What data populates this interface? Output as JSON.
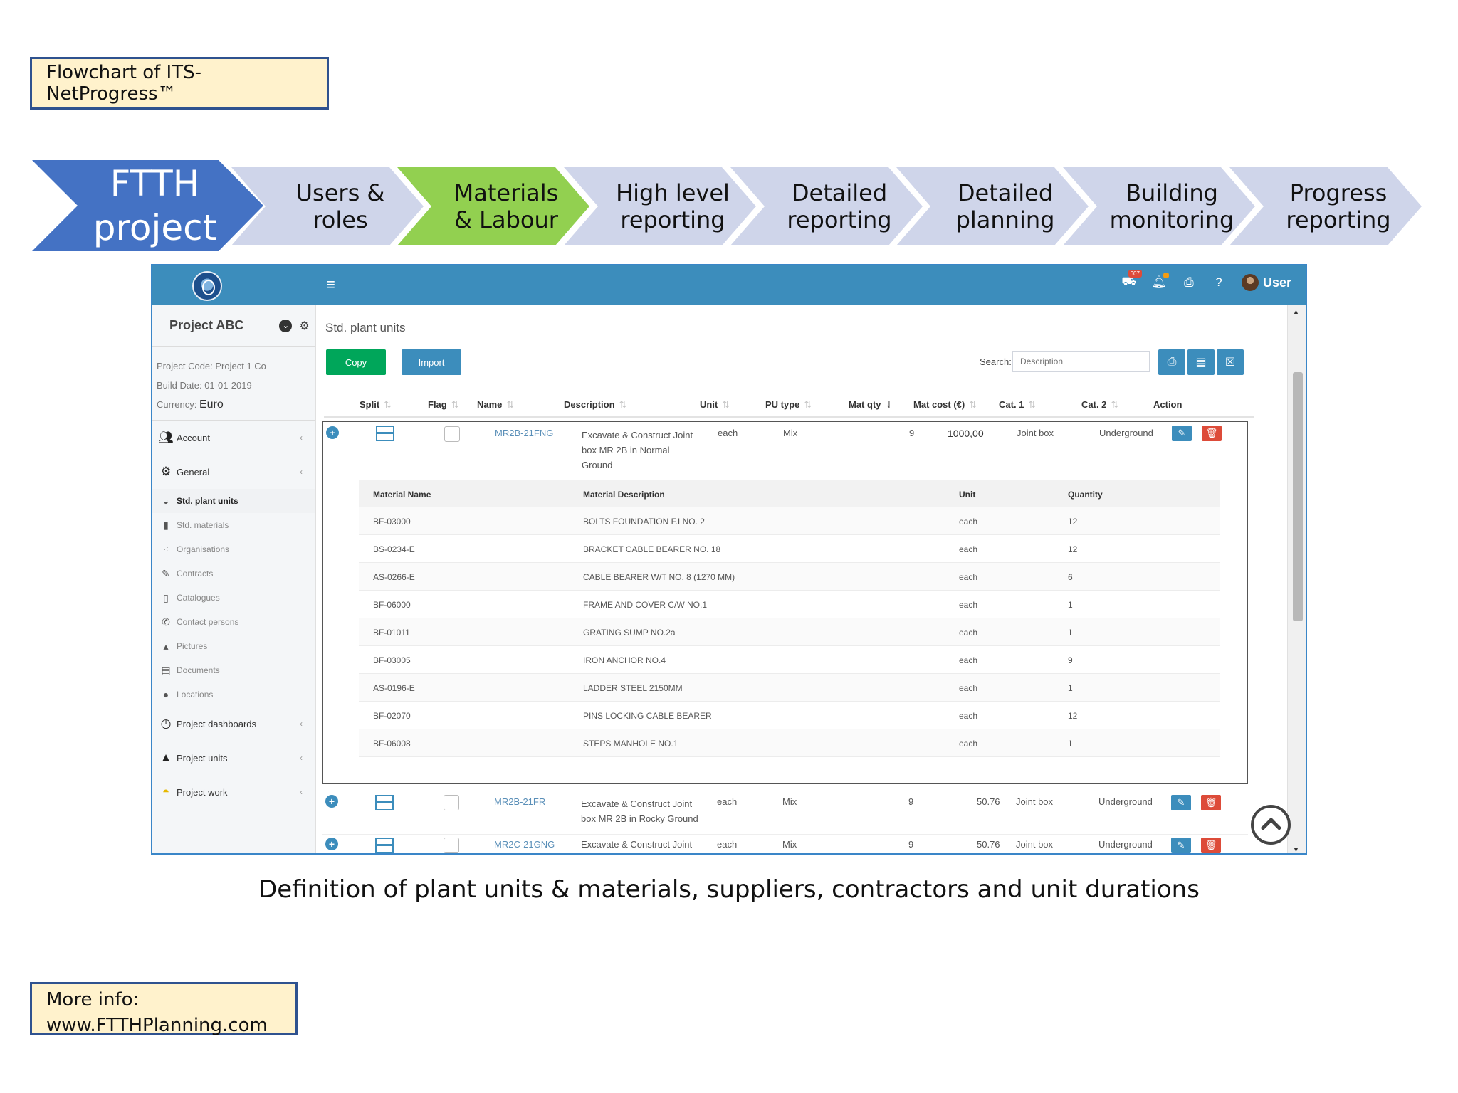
{
  "title_box": "Flowchart of ITS-NetProgress™",
  "flow": {
    "first": [
      "FTTH",
      "project"
    ],
    "steps": [
      {
        "line1": "Users &",
        "line2": "roles",
        "active": false
      },
      {
        "line1": "Materials",
        "line2": "& Labour",
        "active": true
      },
      {
        "line1": "High level",
        "line2": "reporting",
        "active": false
      },
      {
        "line1": "Detailed",
        "line2": "reporting",
        "active": false
      },
      {
        "line1": "Detailed",
        "line2": "planning",
        "active": false
      },
      {
        "line1": "Building",
        "line2": "monitoring",
        "active": false
      },
      {
        "line1": "Progress",
        "line2": "reporting",
        "active": false
      }
    ]
  },
  "app": {
    "menu_icon": "≡",
    "user_label": "User",
    "alert_badge": "607",
    "sidebar": {
      "project_name": "Project ABC",
      "project_code": "Project Code: Project 1 Co",
      "build_date": "Build Date: 01-01-2019",
      "currency_label": "Currency:",
      "currency_value": "Euro",
      "account": "Account",
      "general": "General",
      "sub_items": [
        "Std. plant units",
        "Std. materials",
        "Organisations",
        "Contracts",
        "Catalogues",
        "Contact persons",
        "Pictures",
        "Documents",
        "Locations"
      ],
      "project_dashboards": "Project dashboards",
      "project_units": "Project units",
      "project_work": "Project work"
    },
    "content": {
      "title": "Std. plant units",
      "copy": "Copy",
      "import": "Import",
      "search_label": "Search:",
      "search_placeholder": "Description",
      "columns": [
        "Split",
        "Flag",
        "Name",
        "Description",
        "Unit",
        "PU type",
        "Mat qty",
        "Mat cost (€)",
        "Cat. 1",
        "Cat. 2",
        "Action"
      ],
      "rows": [
        {
          "name": "MR2B-21FNG",
          "desc": [
            "Excavate & Construct Joint",
            "box MR 2B in Normal",
            "Ground"
          ],
          "unit": "each",
          "pu_type": "Mix",
          "mat_qty": "9",
          "mat_cost": "1000,00",
          "cat1": "Joint box",
          "cat2": "Underground"
        },
        {
          "name": "MR2B-21FR",
          "desc": [
            "Excavate & Construct Joint",
            "box MR 2B in Rocky Ground"
          ],
          "unit": "each",
          "pu_type": "Mix",
          "mat_qty": "9",
          "mat_cost": "50.76",
          "cat1": "Joint box",
          "cat2": "Underground"
        },
        {
          "name": "MR2C-21GNG",
          "desc": [
            "Excavate & Construct Joint"
          ],
          "unit": "each",
          "pu_type": "Mix",
          "mat_qty": "9",
          "mat_cost": "50.76",
          "cat1": "Joint box",
          "cat2": "Underground"
        }
      ],
      "sub_columns": [
        "Material Name",
        "Material Description",
        "Unit",
        "Quantity"
      ],
      "sub_rows": [
        [
          "BF-03000",
          "BOLTS FOUNDATION F.I NO. 2",
          "each",
          "12"
        ],
        [
          "BS-0234-E",
          "BRACKET CABLE BEARER NO. 18",
          "each",
          "12"
        ],
        [
          "AS-0266-E",
          "CABLE BEARER W/T NO. 8 (1270 MM)",
          "each",
          "6"
        ],
        [
          "BF-06000",
          "FRAME AND COVER C/W NO.1",
          "each",
          "1"
        ],
        [
          "BF-01011",
          "GRATING SUMP NO.2a",
          "each",
          "1"
        ],
        [
          "BF-03005",
          "IRON ANCHOR NO.4",
          "each",
          "9"
        ],
        [
          "AS-0196-E",
          "LADDER STEEL 2150MM",
          "each",
          "1"
        ],
        [
          "BF-02070",
          "PINS LOCKING CABLE BEARER",
          "each",
          "12"
        ],
        [
          "BF-06008",
          "STEPS MANHOLE NO.1",
          "each",
          "1"
        ]
      ]
    }
  },
  "caption": "Definition of plant units & materials, suppliers, contractors and unit durations",
  "info_box": [
    "More info:",
    "www.FTTHPlanning.com"
  ],
  "colors": {
    "accent": "#3c8dbc",
    "flow_active": "#92d050",
    "flow_first": "#4472c4",
    "flow_default": "#cfd5ea",
    "note_bg": "#fff2cc"
  }
}
